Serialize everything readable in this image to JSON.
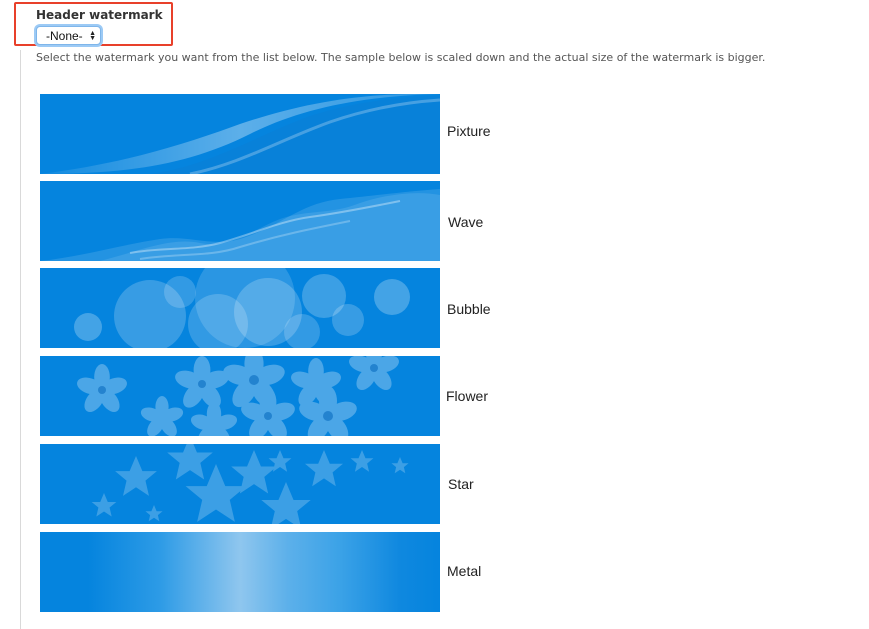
{
  "field": {
    "label": "Header watermark",
    "selected": "-None-"
  },
  "description": "Select the watermark you want from the list below. The sample below is scaled down and the actual size of the watermark is bigger.",
  "colors": {
    "highlight_border": "#e8402a",
    "banner_blue": "#0584de",
    "select_focus": "#9ccaf5"
  },
  "watermarks": [
    {
      "label": "Pixture"
    },
    {
      "label": "Wave"
    },
    {
      "label": "Bubble"
    },
    {
      "label": "Flower"
    },
    {
      "label": "Star"
    },
    {
      "label": "Metal"
    }
  ]
}
